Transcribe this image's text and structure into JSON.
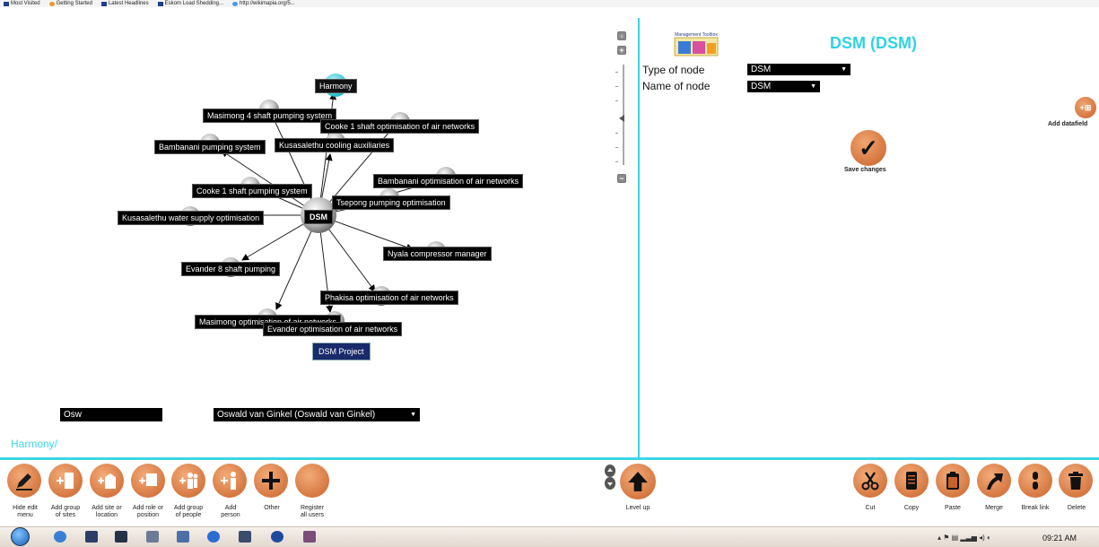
{
  "browser": {
    "bookmarks": [
      {
        "label": "Most Visited",
        "icon": "folder-icon"
      },
      {
        "label": "Getting Started",
        "icon": "firefox-icon"
      },
      {
        "label": "Latest Headlines",
        "icon": "rss-folder-icon"
      },
      {
        "label": "Eskom Load Shedding...",
        "icon": "folder-icon"
      },
      {
        "label": "http://wikimapia.org/5...",
        "icon": "globe-icon"
      }
    ]
  },
  "graph": {
    "center": "DSM",
    "parent": "Harmony",
    "project": "DSM Project",
    "nodes": [
      "Masimong 4 shaft pumping system",
      "Cooke 1 shaft optimisation of air networks",
      "Bambanani pumping system",
      "Kusasalethu cooling auxiliaries",
      "Bambanani optimisation of air networks",
      "Cooke 1 shaft pumping system",
      "Tsepong pumping optimisation",
      "Kusasalethu water supply optimisation",
      "Nyala compressor manager",
      "Evander 8 shaft pumping",
      "Phakisa optimisation of air networks",
      "Masimong optimisation of air networks",
      "Evander optimisation of air networks"
    ]
  },
  "search": {
    "value": "Osw",
    "user_selected": "Oswald van Ginkel (Oswald van Ginkel)"
  },
  "breadcrumb": "Harmony/",
  "detail": {
    "logo_text": "Management Toolbox",
    "title": "DSM (DSM)",
    "type_label": "Type of node",
    "type_value": "DSM",
    "name_label": "Name of node",
    "name_value": "DSM",
    "add_datafield_label": "Add datafield",
    "save_label": "Save changes"
  },
  "toolbar": {
    "left": [
      {
        "label": "Hide edit\nmenu",
        "icon": "pencil-icon"
      },
      {
        "label": "Add group\nof sites",
        "icon": "add-sites-icon"
      },
      {
        "label": "Add site or\nlocation",
        "icon": "add-site-icon"
      },
      {
        "label": "Add role or\nposition",
        "icon": "add-role-icon"
      },
      {
        "label": "Add group\nof people",
        "icon": "add-people-icon"
      },
      {
        "label": "Add\nperson",
        "icon": "add-person-icon"
      },
      {
        "label": "Other",
        "icon": "plus-icon"
      },
      {
        "label": "Register\nall users",
        "icon": "register-icon"
      }
    ],
    "level_up": "Level up",
    "right": [
      {
        "label": "Cut",
        "icon": "scissors-icon"
      },
      {
        "label": "Copy",
        "icon": "copy-icon"
      },
      {
        "label": "Paste",
        "icon": "paste-icon"
      },
      {
        "label": "Merge",
        "icon": "merge-icon"
      },
      {
        "label": "Break link",
        "icon": "break-link-icon"
      },
      {
        "label": "Delete",
        "icon": "trash-icon"
      }
    ]
  },
  "taskbar": {
    "clock": "09:21 AM"
  }
}
